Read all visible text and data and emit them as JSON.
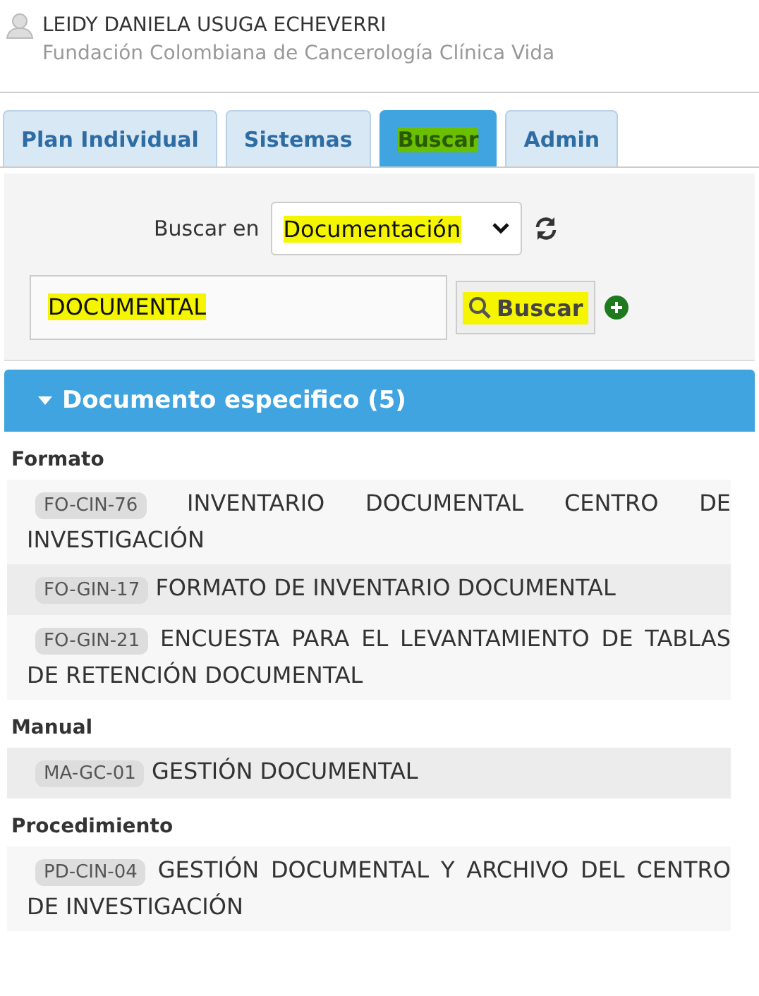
{
  "user": {
    "name": "LEIDY DANIELA USUGA ECHEVERRI",
    "organization": "Fundación Colombiana de Cancerología Clínica Vida"
  },
  "tabs": [
    {
      "label": "Plan Individual",
      "selected": false,
      "highlighted": false
    },
    {
      "label": "Sistemas",
      "selected": false,
      "highlighted": false
    },
    {
      "label": "Buscar",
      "selected": true,
      "highlighted": true
    },
    {
      "label": "Admin",
      "selected": false,
      "highlighted": false
    }
  ],
  "search": {
    "scope_label": "Buscar en",
    "scope_value": "Documentación",
    "scope_highlighted": true,
    "query": "DOCUMENTAL",
    "query_highlighted": true,
    "button": "Buscar",
    "button_highlighted": true
  },
  "results": {
    "title": "Documento especifico (5)",
    "expanded": true,
    "groups": [
      {
        "name": "Formato",
        "items": [
          {
            "code": "FO-CIN-76",
            "title": "INVENTARIO DOCUMENTAL CENTRO DE INVESTIGACIÓN"
          },
          {
            "code": "FO-GIN-17",
            "title": "FORMATO DE INVENTARIO DOCUMENTAL"
          },
          {
            "code": "FO-GIN-21",
            "title": "ENCUESTA PARA EL LEVANTAMIENTO DE TABLAS DE RETENCIÓN DOCUMENTAL"
          }
        ]
      },
      {
        "name": "Manual",
        "items": [
          {
            "code": "MA-GC-01",
            "title": "GESTIÓN DOCUMENTAL"
          }
        ]
      },
      {
        "name": "Procedimiento",
        "items": [
          {
            "code": "PD-CIN-04",
            "title": "GESTIÓN DOCUMENTAL Y ARCHIVO DEL CENTRO DE INVESTIGACIÓN"
          }
        ]
      }
    ]
  }
}
